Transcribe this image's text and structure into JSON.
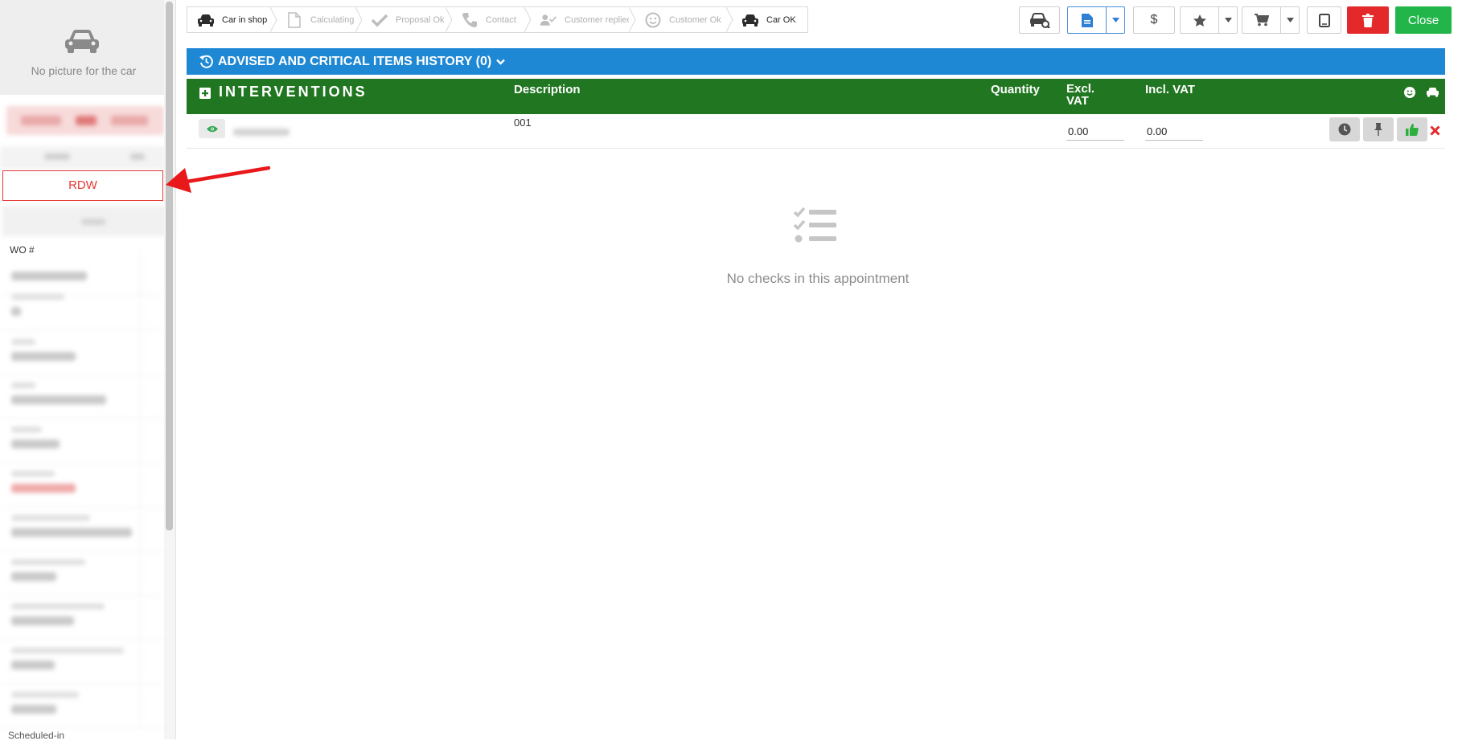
{
  "sidebar": {
    "no_picture": "No picture for the car",
    "rdw_button": "RDW",
    "wo_label": "WO #",
    "scheduled_label": "Scheduled-in"
  },
  "status_steps": [
    {
      "label": "Car in shop",
      "icon": "car-icon",
      "active": true
    },
    {
      "label": "Calculating",
      "icon": "document-icon",
      "active": false
    },
    {
      "label": "Proposal Ok",
      "icon": "check-icon",
      "active": false
    },
    {
      "label": "Contact",
      "icon": "phone-icon",
      "active": false
    },
    {
      "label": "Customer replied",
      "icon": "user-check-icon",
      "active": false
    },
    {
      "label": "Customer Ok",
      "icon": "smile-icon",
      "active": false
    },
    {
      "label": "Car OK",
      "icon": "car-icon",
      "active": true
    }
  ],
  "toolbar": {
    "close_label": "Close",
    "dollar_label": "$",
    "icons": [
      "car-wrench-icon",
      "document-icon",
      "dollar-icon",
      "star-icon",
      "cart-icon",
      "tablet-icon",
      "trash-icon"
    ]
  },
  "advised": {
    "label": "ADVISED AND CRITICAL ITEMS HISTORY (0)"
  },
  "interventions": {
    "title": "INTERVENTIONS",
    "columns": {
      "description": "Description",
      "quantity": "Quantity",
      "excl_vat": "Excl. VAT",
      "incl_vat": "Incl. VAT"
    },
    "rows": [
      {
        "description": "001",
        "excl_vat": "0.00",
        "incl_vat": "0.00"
      }
    ]
  },
  "empty_state": {
    "text": "No checks in this appointment"
  },
  "colors": {
    "advised_blue": "#1e88d4",
    "interventions_green": "#217621",
    "close_green": "#22b64a",
    "delete_red": "#e32929",
    "rdw_red": "#e53935"
  }
}
